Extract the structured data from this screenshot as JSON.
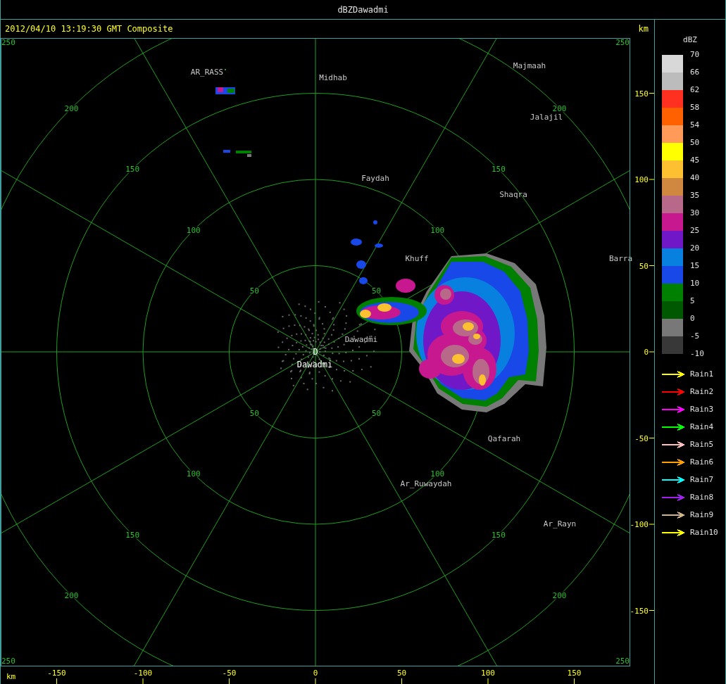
{
  "window": {
    "title": "dBZDawadmi"
  },
  "header": {
    "timestamp": "2012/04/10 13:19:30 GMT Composite",
    "unit": "km"
  },
  "ppi": {
    "corner_labels": [
      "250",
      "250",
      "250",
      "250"
    ],
    "rings": [
      {
        "labels": [
          "50",
          "50",
          "50",
          "50"
        ]
      },
      {
        "labels": [
          "100",
          "100",
          "100",
          "100"
        ]
      },
      {
        "labels": [
          "150",
          "150",
          "150",
          "150"
        ]
      },
      {
        "labels": [
          "200",
          "200",
          "200",
          "200"
        ]
      }
    ],
    "places": [
      {
        "name": "AR_RASS"
      },
      {
        "name": "Midhab"
      },
      {
        "name": "Majmaah"
      },
      {
        "name": "Jalajil"
      },
      {
        "name": "Faydah"
      },
      {
        "name": "Shaqra"
      },
      {
        "name": "Khuff"
      },
      {
        "name": "Barra"
      },
      {
        "name": "Dawadmi"
      },
      {
        "name": "Qafarah"
      },
      {
        "name": "Ar_Ruwaydah"
      },
      {
        "name": "Ar_Rayn"
      }
    ],
    "radar_site": {
      "marker": "D",
      "name": "Dawadmi"
    },
    "y_axis": {
      "ticks": [
        "150",
        "100",
        "50",
        "0",
        "-50",
        "-100",
        "-150"
      ]
    },
    "x_axis": {
      "unit": "km",
      "ticks": [
        "-150",
        "-100",
        "-50",
        "0",
        "50",
        "100",
        "150"
      ]
    }
  },
  "legend": {
    "title": "dBZ",
    "scale_labels": [
      "70",
      "66",
      "62",
      "58",
      "54",
      "50",
      "45",
      "40",
      "35",
      "30",
      "25",
      "20",
      "15",
      "10",
      "5",
      "0",
      "-5",
      "-10"
    ],
    "bands": [
      {
        "color": "#d8d8d8"
      },
      {
        "color": "#bcbcbc"
      },
      {
        "color": "#ff3020"
      },
      {
        "color": "#ff6000"
      },
      {
        "color": "#ff9a58"
      },
      {
        "color": "#ffff00"
      },
      {
        "color": "#fcc030"
      },
      {
        "color": "#d08840"
      },
      {
        "color": "#b86888"
      },
      {
        "color": "#c81890"
      },
      {
        "color": "#7018c8"
      },
      {
        "color": "#0880e0"
      },
      {
        "color": "#1848e8"
      },
      {
        "color": "#008000"
      },
      {
        "color": "#005800"
      },
      {
        "color": "#787878"
      },
      {
        "color": "#383838"
      }
    ],
    "tracks": [
      {
        "label": "Rain1",
        "color": "#ffff00"
      },
      {
        "label": "Rain2",
        "color": "#ff0000"
      },
      {
        "label": "Rain3",
        "color": "#ff00ff"
      },
      {
        "label": "Rain4",
        "color": "#00ff00"
      },
      {
        "label": "Rain5",
        "color": "#ffc0c0"
      },
      {
        "label": "Rain6",
        "color": "#ffa000"
      },
      {
        "label": "Rain7",
        "color": "#00ffff"
      },
      {
        "label": "Rain8",
        "color": "#a020f0"
      },
      {
        "label": "Rain9",
        "color": "#d2b48c"
      },
      {
        "label": "Rain10",
        "color": "#ffff00"
      }
    ]
  }
}
